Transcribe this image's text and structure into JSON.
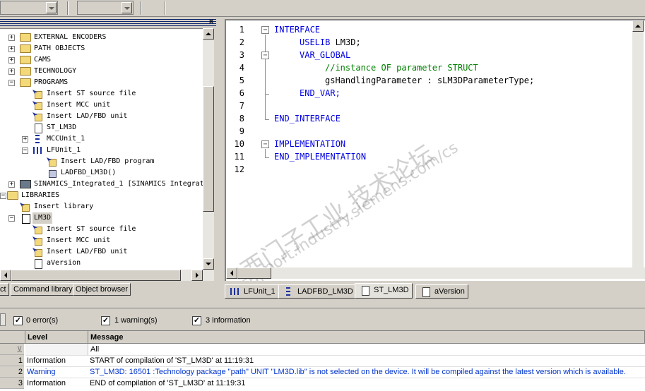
{
  "tree": {
    "items": [
      {
        "label": "EXTERNAL ENCODERS",
        "icon": "folder-icon"
      },
      {
        "label": "PATH OBJECTS",
        "icon": "folder-icon"
      },
      {
        "label": "CAMS",
        "icon": "folder-icon"
      },
      {
        "label": "TECHNOLOGY",
        "icon": "folder-icon"
      },
      {
        "label": "PROGRAMS",
        "icon": "folder-open-icon"
      },
      {
        "label": "Insert ST source file",
        "icon": "insert-icon"
      },
      {
        "label": "Insert MCC unit",
        "icon": "insert-icon"
      },
      {
        "label": "Insert LAD/FBD unit",
        "icon": "insert-icon"
      },
      {
        "label": "ST_LM3D",
        "icon": "st-source-icon"
      },
      {
        "label": "MCCUnit_1",
        "icon": "mcc-unit-icon"
      },
      {
        "label": "LFUnit_1",
        "icon": "lad-unit-icon"
      },
      {
        "label": "Insert LAD/FBD program",
        "icon": "insert-icon"
      },
      {
        "label": "LADFBD_LM3D()",
        "icon": "lad-program-icon"
      },
      {
        "label": "SINAMICS_Integrated_1 [SINAMICS Integrat",
        "icon": "drive-icon"
      },
      {
        "label": "LIBRARIES",
        "icon": "folder-open-icon"
      },
      {
        "label": "Insert library",
        "icon": "insert-icon"
      },
      {
        "label": "LM3D",
        "icon": "library-icon"
      },
      {
        "label": "Insert ST source file",
        "icon": "insert-icon"
      },
      {
        "label": "Insert MCC unit",
        "icon": "insert-icon"
      },
      {
        "label": "Insert LAD/FBD unit",
        "icon": "insert-icon"
      },
      {
        "label": "aVersion",
        "icon": "doc-icon"
      }
    ],
    "close_label": "×"
  },
  "left_tabs": [
    "ct",
    "Command library",
    "Object browser"
  ],
  "editor": {
    "line_numbers": [
      "1",
      "2",
      "3",
      "4",
      "5",
      "6",
      "7",
      "8",
      "9",
      "10",
      "11",
      "12"
    ],
    "lines": {
      "l1": "INTERFACE",
      "l2_kw": "USELIB",
      "l2_tx": " LM3D;",
      "l3": "VAR_GLOBAL",
      "l4": "//instance OF parameter STRUCT",
      "l5": "gsHandlingParameter : sLM3DParameterType;",
      "l6": "END_VAR;",
      "l8": "END_INTERFACE",
      "l10": "IMPLEMENTATION",
      "l11": "END_IMPLEMENTATION"
    },
    "tabs": [
      "LFUnit_1",
      "LADFBD_LM3D",
      "ST_LM3D",
      "aVersion"
    ],
    "active_tab": "ST_LM3D"
  },
  "output": {
    "filters": {
      "errors": "0 error(s)",
      "warnings": "1 warning(s)",
      "info": "3 information"
    },
    "columns": {
      "level": "Level",
      "message": "Message"
    },
    "filter_value": "All",
    "rows": [
      {
        "num": "1",
        "level": "Information",
        "message": "START of compilation of 'ST_LM3D' at 11:19:31"
      },
      {
        "num": "2",
        "level": "Warning",
        "message": "ST_LM3D: 16501 :Technology package \"path\" UNIT \"LM3D.lib\" is not selected on the device. It will be compiled against the latest version which is available."
      },
      {
        "num": "3",
        "level": "Information",
        "message": "END of compilation of 'ST_LM3D' at 11:19:31"
      }
    ]
  },
  "watermark": {
    "cn": "西门子工业 技术论坛",
    "url": "support.industry.siemens.com/cs"
  },
  "colors": {
    "keyword": "#0000e0",
    "comment": "#008000",
    "warning": "#0033cc"
  }
}
